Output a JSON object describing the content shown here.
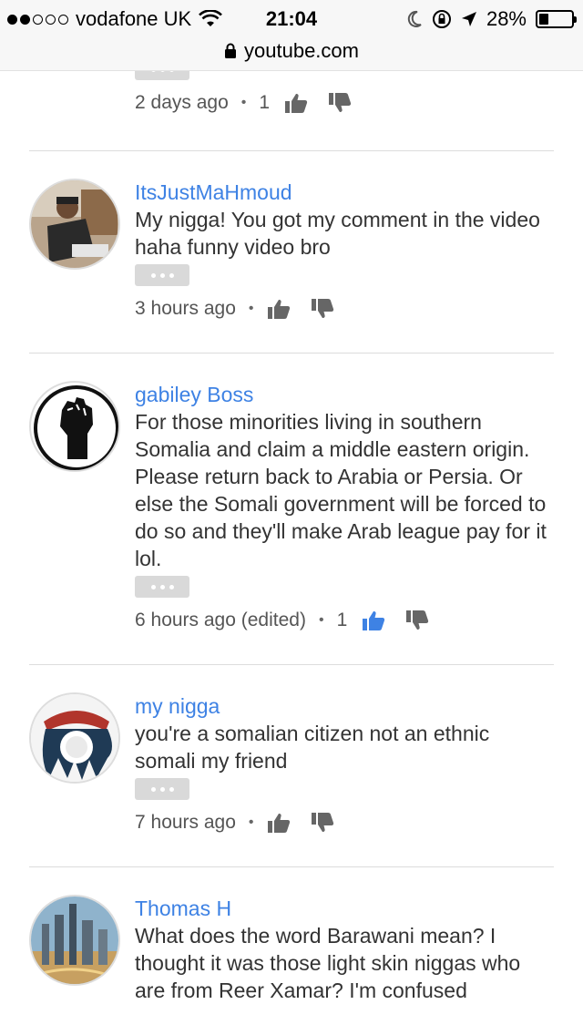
{
  "status": {
    "carrier": "vodafone UK",
    "time": "21:04",
    "battery": "28%",
    "battery_level": 0.28
  },
  "url": "youtube.com",
  "comments": [
    {
      "author": "",
      "text": "",
      "time": "2 days ago",
      "likes": "1",
      "liked": false
    },
    {
      "author": "ItsJustMaHmoud",
      "text": "My nigga! You got my comment in the video haha funny video bro",
      "time": "3 hours ago",
      "likes": "",
      "liked": false
    },
    {
      "author": "gabiley Boss",
      "text": "For those minorities living in southern Somalia and claim a middle eastern origin. Please return back to Arabia or Persia. Or else the Somali government will be forced to do so and they'll make Arab league pay for it lol.",
      "time": "6 hours ago (edited)",
      "likes": "1",
      "liked": true
    },
    {
      "author": "my nigga",
      "text": "you're a somalian citizen not an ethnic somali my friend",
      "time": "7 hours ago",
      "likes": "",
      "liked": false
    },
    {
      "author": "Thomas H",
      "text": "What does the word Barawani mean? I thought it was those light skin niggas who are from Reer Xamar? I'm confused",
      "time": "",
      "likes": "",
      "liked": false
    }
  ],
  "colors": {
    "link_blue": "#3e82e4",
    "like_active": "#3e82e4",
    "icon_gray": "#666666"
  }
}
